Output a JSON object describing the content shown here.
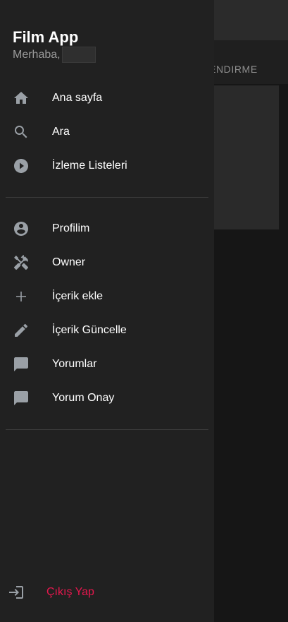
{
  "background": {
    "tab_label": "ENDIRME"
  },
  "drawer": {
    "app_title": "Film App",
    "greeting": "Merhaba,",
    "primary_items": [
      {
        "label": "Ana sayfa",
        "icon": "home-icon"
      },
      {
        "label": "Ara",
        "icon": "search-icon"
      },
      {
        "label": "İzleme Listeleri",
        "icon": "play-circle-icon"
      }
    ],
    "secondary_items": [
      {
        "label": "Profilim",
        "icon": "account-circle-icon"
      },
      {
        "label": "Owner",
        "icon": "tools-icon"
      },
      {
        "label": "İçerik ekle",
        "icon": "add-icon"
      },
      {
        "label": "İçerik Güncelle",
        "icon": "edit-icon"
      },
      {
        "label": "Yorumlar",
        "icon": "comment-icon"
      },
      {
        "label": "Yorum Onay",
        "icon": "comment-icon"
      }
    ],
    "logout": {
      "label": "Çıkış Yap",
      "icon": "login-icon",
      "color": "#e8174e"
    }
  },
  "colors": {
    "drawer_bg": "#212121",
    "icon": "#9aa0a6",
    "text": "#ffffff",
    "muted_text": "#9a9a9a",
    "accent": "#e8174e"
  }
}
